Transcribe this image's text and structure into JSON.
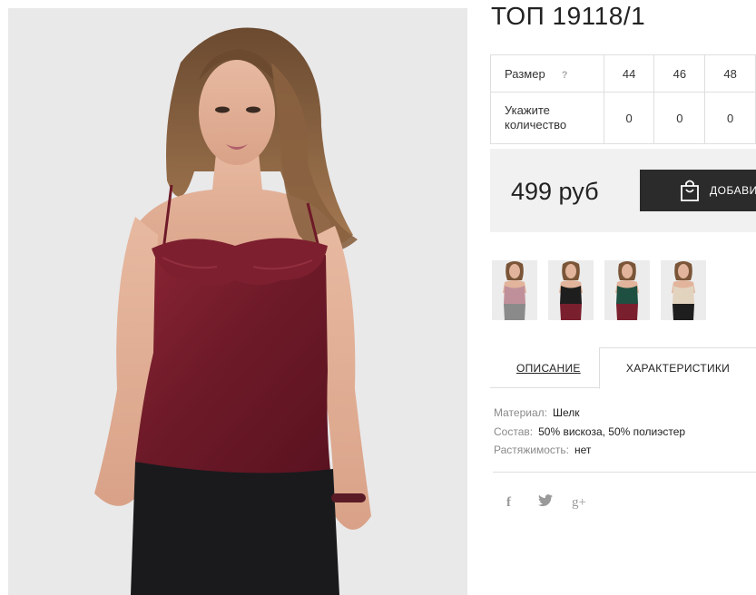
{
  "product": {
    "title": "ТОП 19118/1",
    "main_image": "woman-in-burgundy-satin-ruffle-top"
  },
  "size_table": {
    "size_label": "Размер",
    "help_icon": "?",
    "sizes": [
      "44",
      "46",
      "48"
    ],
    "quantity_label": "Укажите количество",
    "quantities": [
      "0",
      "0",
      "0"
    ]
  },
  "purchase": {
    "price": "499 руб",
    "add_button_label": "ДОБАВИ",
    "add_icon": "shopping-bag-icon"
  },
  "color_variants": [
    {
      "name": "pink",
      "top_color": "#c0909a",
      "bottom_color": "#8a8a8a"
    },
    {
      "name": "black",
      "top_color": "#1e1e1e",
      "bottom_color": "#7a1f2e"
    },
    {
      "name": "green",
      "top_color": "#1f4f40",
      "bottom_color": "#7a1f2e"
    },
    {
      "name": "beige",
      "top_color": "#e2d3bf",
      "bottom_color": "#1e1e1e"
    }
  ],
  "tabs": {
    "description": "ОПИСАНИЕ",
    "characteristics": "ХАРАКТЕРИСТИКИ",
    "active": "characteristics"
  },
  "specs": [
    {
      "key": "Материал:",
      "value": "Шелк"
    },
    {
      "key": "Состав:",
      "value": "50% вискоза, 50% полиэстер"
    },
    {
      "key": "Растяжимость:",
      "value": "нет"
    }
  ],
  "social": {
    "facebook": "f",
    "twitter": "twitter-icon",
    "googleplus": "g+"
  },
  "colors": {
    "accent_button": "#2b2b2b",
    "price_box_bg": "#f1f1f1",
    "border": "#dedede"
  }
}
